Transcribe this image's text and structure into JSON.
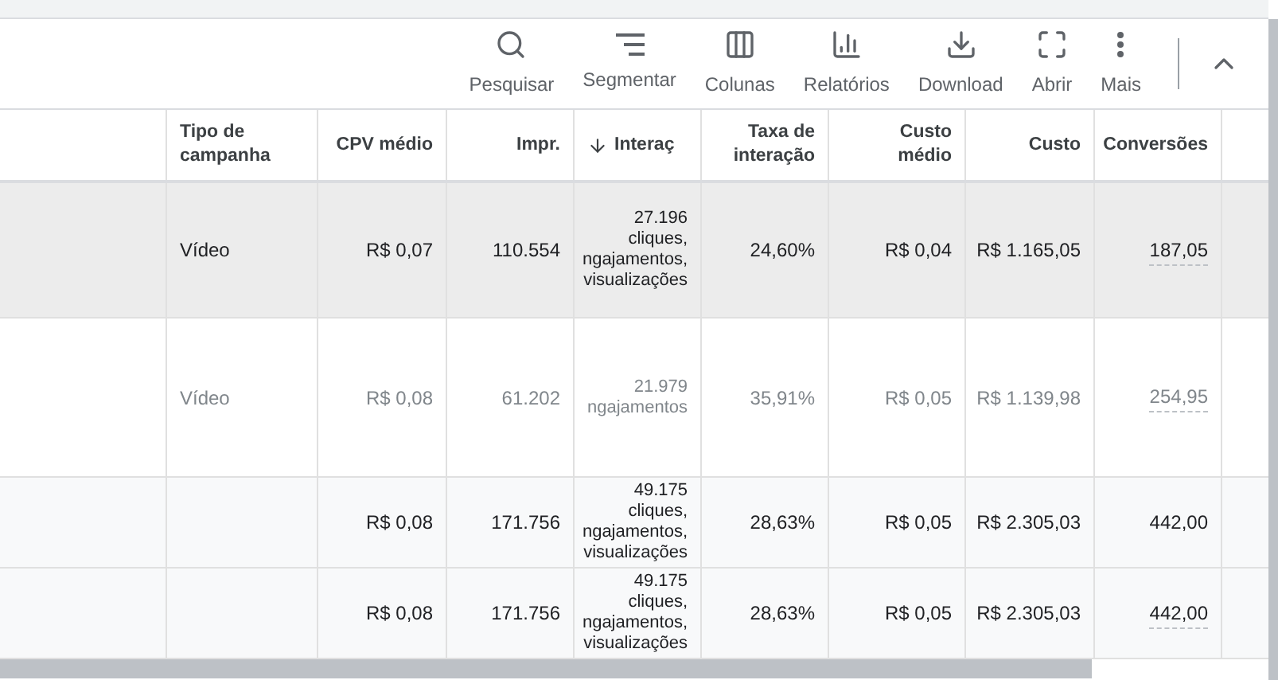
{
  "toolbar": {
    "buttons": [
      {
        "kind": "search",
        "label": "Pesquisar"
      },
      {
        "kind": "segment",
        "label": "Segmentar"
      },
      {
        "kind": "columns",
        "label": "Colunas"
      },
      {
        "kind": "reports",
        "label": "Relatórios"
      },
      {
        "kind": "download",
        "label": "Download"
      },
      {
        "kind": "expand",
        "label": "Abrir"
      },
      {
        "kind": "more",
        "label": "Mais"
      }
    ],
    "collapse_expanded": true
  },
  "table": {
    "columns": [
      {
        "lines": [
          "Tipo de",
          "campanha"
        ],
        "sorted": false
      },
      {
        "lines": [
          "CPV médio"
        ],
        "sorted": false
      },
      {
        "lines": [
          "Impr."
        ],
        "sorted": false
      },
      {
        "lines": [
          "Interaç"
        ],
        "sorted": true
      },
      {
        "lines": [
          "Taxa de",
          "interação"
        ],
        "sorted": false
      },
      {
        "lines": [
          "Custo",
          "médio"
        ],
        "sorted": false
      },
      {
        "lines": [
          "Custo"
        ],
        "sorted": false
      },
      {
        "lines": [
          "Conversões"
        ],
        "sorted": false
      }
    ],
    "rows": [
      {
        "kind": "campaign",
        "highlighted": true,
        "dimmed": false,
        "conversions_underlined": true,
        "cells": [
          "Vídeo",
          "R$ 0,07",
          "110.554",
          [
            "27.196",
            "cliques,",
            "ngajamentos,",
            "visualizações"
          ],
          "24,60%",
          "R$ 0,04",
          "R$ 1.165,05",
          "187,05"
        ]
      },
      {
        "kind": "campaign",
        "highlighted": false,
        "dimmed": true,
        "conversions_underlined": true,
        "cells": [
          "Vídeo",
          "R$ 0,08",
          "61.202",
          [
            "21.979",
            "ngajamentos"
          ],
          "35,91%",
          "R$ 0,05",
          "R$ 1.139,98",
          "254,95"
        ]
      },
      {
        "kind": "total",
        "highlighted": false,
        "dimmed": false,
        "conversions_underlined": false,
        "cells": [
          "",
          "R$ 0,08",
          "171.756",
          [
            "49.175",
            "cliques,",
            "ngajamentos,",
            "visualizações"
          ],
          "28,63%",
          "R$ 0,05",
          "R$ 2.305,03",
          "442,00"
        ]
      },
      {
        "kind": "total",
        "highlighted": false,
        "dimmed": false,
        "conversions_underlined": true,
        "cells": [
          "",
          "R$ 0,08",
          "171.756",
          [
            "49.175",
            "cliques,",
            "ngajamentos,",
            "visualizações"
          ],
          "28,63%",
          "R$ 0,05",
          "R$ 2.305,03",
          "442,00"
        ]
      }
    ]
  }
}
